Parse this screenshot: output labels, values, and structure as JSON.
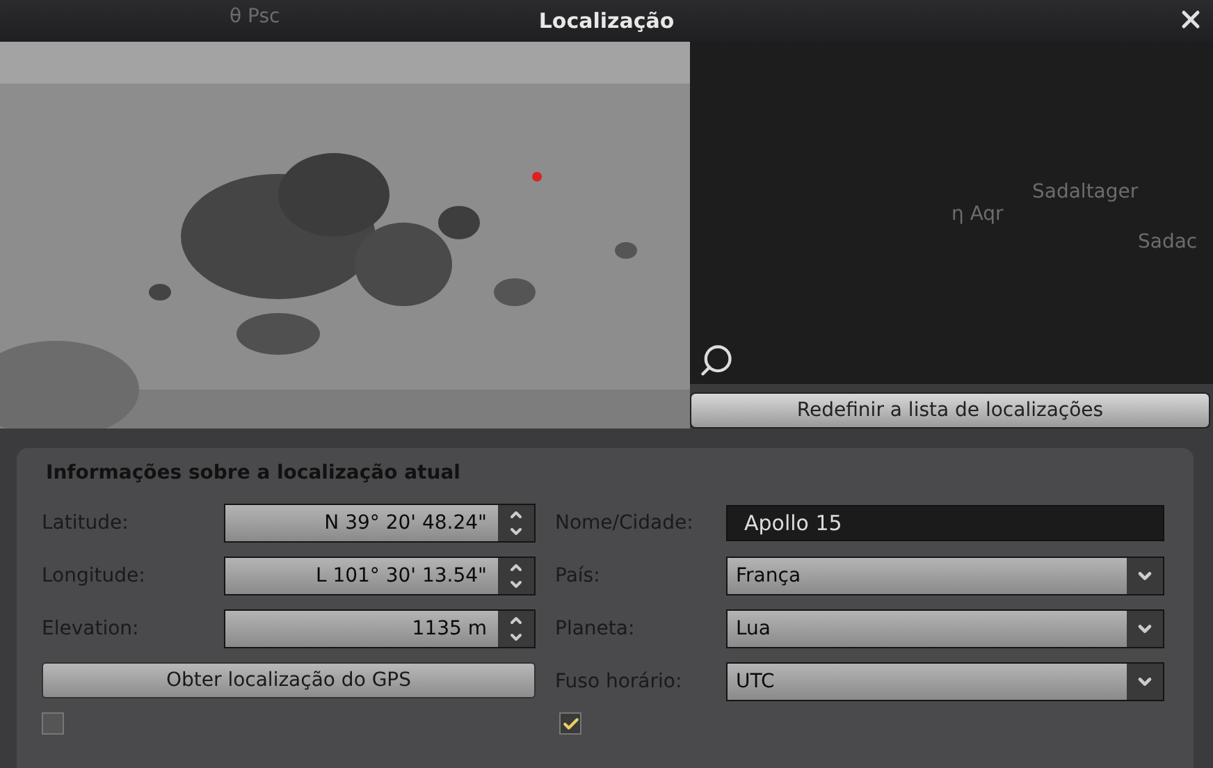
{
  "window": {
    "title": "Localização"
  },
  "sky_labels": [
    {
      "text": "θ Psc"
    },
    {
      "text": "η Aqr"
    },
    {
      "text": "Sadaltager"
    },
    {
      "text": "Sadac"
    }
  ],
  "reset_button": "Redefinir a lista de localizações",
  "current_location": {
    "title": "Informações sobre a localização atual",
    "coordinates": [
      {
        "label": "Latitude:",
        "value": "N 39° 20' 48.24\""
      },
      {
        "label": "Longitude:",
        "value": "L 101° 30' 13.54\""
      },
      {
        "label": "Elevation:",
        "value": "1135 m"
      }
    ],
    "gps_button": "Obter localização do GPS",
    "fields": [
      {
        "kind": "text",
        "label": "Nome/Cidade:",
        "value": "Apollo 15"
      },
      {
        "kind": "dropdown",
        "label": "País:",
        "value": "França"
      },
      {
        "kind": "dropdown",
        "label": "Planeta:",
        "value": "Lua"
      },
      {
        "kind": "dropdown",
        "label": "Fuso horário:",
        "value": "UTC"
      }
    ],
    "checkboxes": [
      {
        "checked": false
      },
      {
        "checked": true
      }
    ]
  }
}
